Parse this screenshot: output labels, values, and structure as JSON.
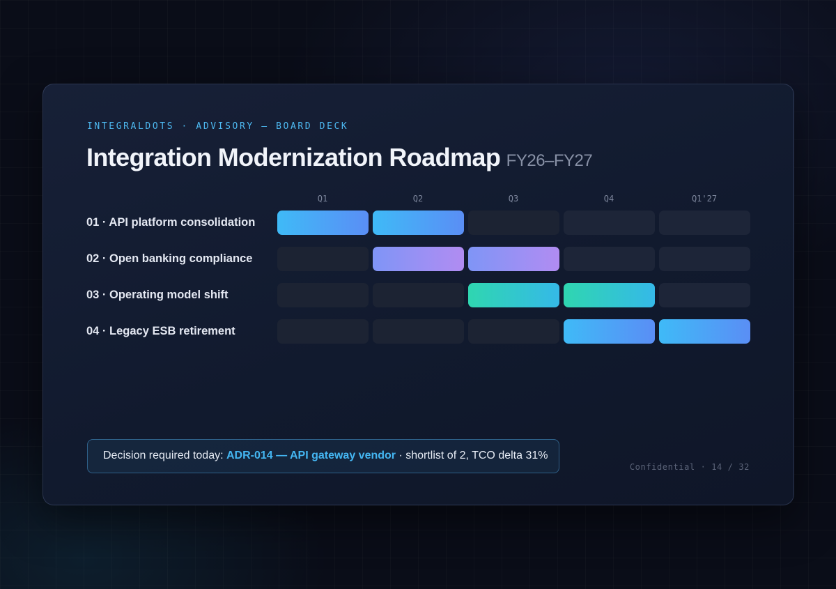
{
  "eyebrow": "INTEGRALDOTS · ADVISORY — BOARD DECK",
  "title": "Integration Modernization Roadmap",
  "subtitle": "FY26–FY27",
  "quarters": [
    "Q1",
    "Q2",
    "Q3",
    "Q4",
    "Q1'27"
  ],
  "workstreams": [
    {
      "label": "01 · API platform consolidation",
      "active_quarters": [
        "Q1",
        "Q2"
      ],
      "color": "blue"
    },
    {
      "label": "02 · Open banking compliance",
      "active_quarters": [
        "Q2",
        "Q3"
      ],
      "color": "purple"
    },
    {
      "label": "03 · Operating model shift",
      "active_quarters": [
        "Q3",
        "Q4"
      ],
      "color": "teal"
    },
    {
      "label": "04 · Legacy ESB retirement",
      "active_quarters": [
        "Q4",
        "Q1'27"
      ],
      "color": "blue"
    }
  ],
  "colors": {
    "accent": "#4db8f0",
    "blue": [
      "#3fbaf7",
      "#5a8ef5"
    ],
    "purple": [
      "#7f95f6",
      "#b18cf2"
    ],
    "teal": [
      "#2fd6b0",
      "#35b9e8"
    ],
    "inactive": "#1d2538"
  },
  "decision": {
    "prefix": "Decision required today: ",
    "highlight": "ADR-014 — API gateway vendor",
    "suffix": " · shortlist of 2, TCO delta 31%"
  },
  "footer": "Confidential · 14 / 32"
}
